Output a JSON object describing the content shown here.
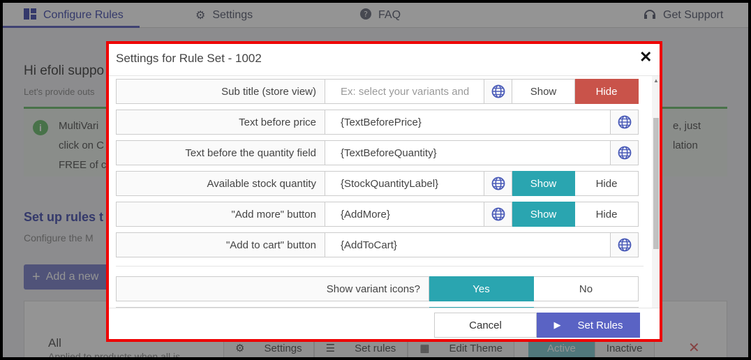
{
  "nav": {
    "configure_rules": "Configure Rules",
    "settings": "Settings",
    "faq": "FAQ",
    "get_support": "Get Support"
  },
  "background": {
    "greeting": "Hi efoli suppo",
    "greeting_sub": "Let's provide outs",
    "info_line1": "MultiVari",
    "info_line2": "click on C",
    "info_line3": "FREE of c",
    "info_right1": "e, just",
    "info_right2": "lation",
    "setup_title": "Set up rules t",
    "setup_sub": "Configure the M",
    "add_new": "Add a new",
    "card_title": "All",
    "card_applied": "Applied to products when all is",
    "card_buttons": {
      "settings": "Settings",
      "set_rules": "Set rules",
      "edit_theme": "Edit Theme",
      "active": "Active",
      "inactive": "Inactive"
    }
  },
  "modal": {
    "title": "Settings for Rule Set - 1002",
    "rows": [
      {
        "label": "Sub title (store view)",
        "value": "",
        "placeholder": "Ex: select your variants and",
        "show": "Show",
        "hide": "Hide",
        "state": "hide"
      },
      {
        "label": "Text before price",
        "value": "{TextBeforePrice}"
      },
      {
        "label": "Text before the quantity field",
        "value": "{TextBeforeQuantity}"
      },
      {
        "label": "Available stock quantity",
        "value": "{StockQuantityLabel}",
        "show": "Show",
        "hide": "Hide",
        "state": "show"
      },
      {
        "label": "\"Add more\" button",
        "value": "{AddMore}",
        "show": "Show",
        "hide": "Hide",
        "state": "show"
      },
      {
        "label": "\"Add to cart\" button",
        "value": "{AddToCart}"
      }
    ],
    "variant_icons": {
      "label": "Show variant icons?",
      "yes": "Yes",
      "no": "No",
      "state": "yes"
    },
    "footer": {
      "cancel": "Cancel",
      "set_rules": "Set Rules"
    }
  },
  "colors": {
    "accent": "#5a63c4",
    "toggle_on": "#2aa5b0",
    "hide_active": "#c9534a",
    "highlight_border": "#ee0000"
  }
}
